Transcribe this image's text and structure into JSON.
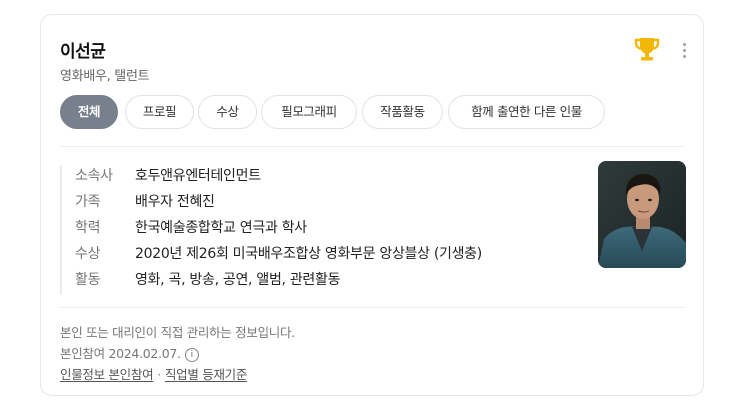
{
  "profile": {
    "name": "이선균",
    "subtitle": "영화배우, 탤런트"
  },
  "icons": {
    "trophy": "trophy-icon",
    "more": "more-vertical-icon",
    "info": "info-icon",
    "trophy_color": "#f2b705"
  },
  "tabs": [
    {
      "label": "전체",
      "active": true
    },
    {
      "label": "프로필",
      "active": false
    },
    {
      "label": "수상",
      "active": false
    },
    {
      "label": "필모그래피",
      "active": false
    },
    {
      "label": "작품활동",
      "active": false
    },
    {
      "label": "함께 출연한 다른 인물",
      "active": false
    }
  ],
  "info": {
    "agency": {
      "label": "소속사",
      "value": "호두앤유엔터테인먼트"
    },
    "family": {
      "label": "가족",
      "prefix": "배우자 ",
      "value": "전혜진"
    },
    "education": {
      "label": "학력",
      "value": "한국예술종합학교",
      "suffix": " 연극과 학사"
    },
    "award": {
      "label": "수상",
      "value": "2020년 제26회 미국배우조합상 영화부문 앙상블상 (기생충)"
    },
    "activity": {
      "label": "활동",
      "items": [
        "영화",
        "곡",
        "방송",
        "공연",
        "앨범",
        "관련활동"
      ],
      "separator": ", "
    }
  },
  "footer": {
    "managed_note": "본인 또는 대리인이 직접 관리하는 정보입니다.",
    "ref_date": "본인참여 2024.02.07.",
    "link1": "인물정보 본인참여",
    "dot": "·",
    "link2": "직업별 등재기준"
  },
  "colors": {
    "link": "#2a5cc8",
    "active_tab": "#77808c"
  }
}
